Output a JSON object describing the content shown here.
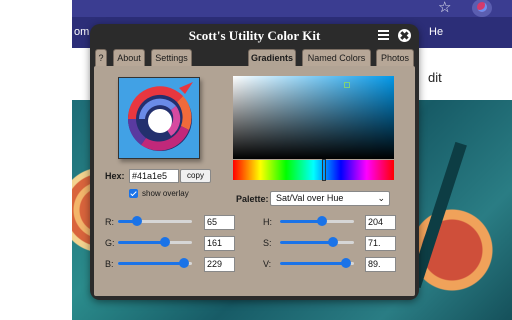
{
  "browser": {
    "tab_left_text": "om",
    "tab_right_text": "He",
    "page_text": "dit"
  },
  "popup": {
    "title": "Scott's Utility Color Kit",
    "tabs": [
      {
        "label": "?",
        "active": false
      },
      {
        "label": "About",
        "active": false
      },
      {
        "label": "Settings",
        "active": false
      },
      {
        "label": "Gradients",
        "active": true
      },
      {
        "label": "Named Colors",
        "active": false
      },
      {
        "label": "Photos",
        "active": false
      }
    ]
  },
  "color": {
    "hex_label": "Hex:",
    "hex_value": "#41a1e5",
    "copy_label": "copy",
    "show_overlay_label": "show overlay",
    "show_overlay_checked": true,
    "preview_color": "#41a1e5"
  },
  "palette": {
    "label": "Palette:",
    "selected": "Sat/Val over Hue"
  },
  "rgb": [
    {
      "label": "R:",
      "value": "65",
      "level": 0.255
    },
    {
      "label": "G:",
      "value": "161",
      "level": 0.631
    },
    {
      "label": "B:",
      "value": "229",
      "level": 0.898
    }
  ],
  "hsv": [
    {
      "label": "H:",
      "value": "204",
      "level": 0.567
    },
    {
      "label": "S:",
      "value": "71.",
      "level": 0.716
    },
    {
      "label": "V:",
      "value": "89.",
      "level": 0.898
    }
  ],
  "accent": "#1a73e8"
}
